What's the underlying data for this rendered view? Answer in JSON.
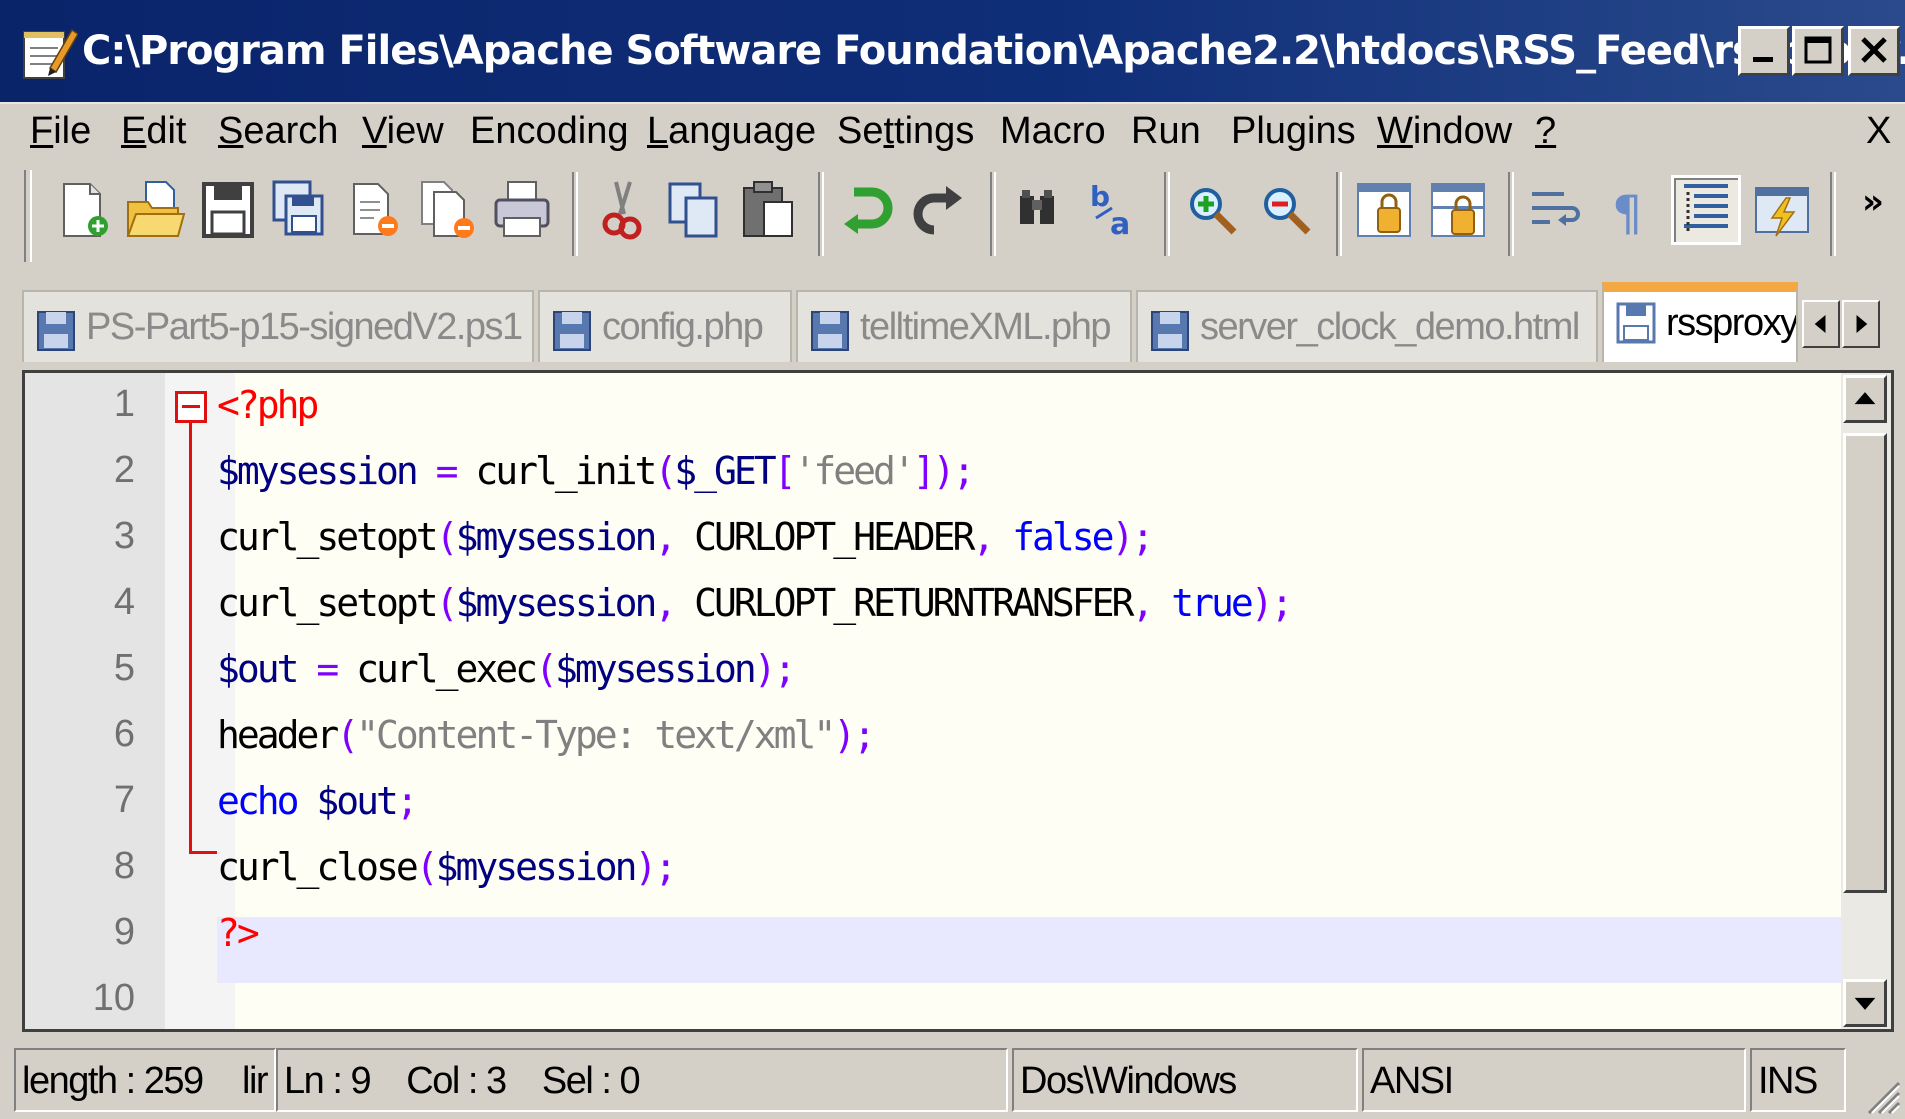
{
  "window": {
    "title": "C:\\Program Files\\Apache Software Foundation\\Apache2.2\\htdocs\\RSS_Feed\\rssproxy.php",
    "app_icon": "notepad-icon",
    "title_color": "#0a246a"
  },
  "menu": {
    "items": [
      {
        "label": "File",
        "accel": "F"
      },
      {
        "label": "Edit",
        "accel": "E"
      },
      {
        "label": "Search",
        "accel": "S"
      },
      {
        "label": "View",
        "accel": "V"
      },
      {
        "label": "Encoding",
        "accel": ""
      },
      {
        "label": "Language",
        "accel": "L"
      },
      {
        "label": "Settings",
        "accel": "t"
      },
      {
        "label": "Macro",
        "accel": ""
      },
      {
        "label": "Run",
        "accel": ""
      },
      {
        "label": "Plugins",
        "accel": ""
      },
      {
        "label": "Window",
        "accel": "W"
      },
      {
        "label": "?",
        "accel": "?"
      }
    ],
    "close_label": "X"
  },
  "toolbar": {
    "buttons": [
      "new-file",
      "open-file",
      "save",
      "save-all",
      "close",
      "close-all",
      "print",
      "cut",
      "copy",
      "paste",
      "undo",
      "redo",
      "find",
      "replace",
      "zoom-in",
      "zoom-out",
      "sync-vertical",
      "sync-horizontal",
      "word-wrap",
      "show-all-characters",
      "indent-guide",
      "user-defined-language"
    ],
    "more_label": "»"
  },
  "tabs": [
    {
      "label": "PS-Part5-p15-signedV2.ps1",
      "active": false
    },
    {
      "label": "config.php",
      "active": false
    },
    {
      "label": "telltimeXML.php",
      "active": false
    },
    {
      "label": "server_clock_demo.html",
      "active": false
    },
    {
      "label": "rssproxy.php",
      "active": true
    }
  ],
  "editor": {
    "lines": [
      {
        "num": "1",
        "tokens": [
          {
            "t": "<?php",
            "c": "k-tag"
          }
        ]
      },
      {
        "num": "2",
        "tokens": [
          {
            "t": "$mysession",
            "c": "k-var"
          },
          {
            "t": " = ",
            "c": "k-op"
          },
          {
            "t": "curl_init",
            "c": "k-fn"
          },
          {
            "t": "(",
            "c": "k-op"
          },
          {
            "t": "$_GET",
            "c": "k-var"
          },
          {
            "t": "[",
            "c": "k-op"
          },
          {
            "t": "'feed'",
            "c": "k-sq"
          },
          {
            "t": "]);",
            "c": "k-op"
          }
        ]
      },
      {
        "num": "3",
        "tokens": [
          {
            "t": "curl_setopt",
            "c": "k-fn"
          },
          {
            "t": "(",
            "c": "k-op"
          },
          {
            "t": "$mysession",
            "c": "k-var"
          },
          {
            "t": ", ",
            "c": "k-op"
          },
          {
            "t": "CURLOPT_HEADER",
            "c": "k-const"
          },
          {
            "t": ", ",
            "c": "k-op"
          },
          {
            "t": "false",
            "c": "k-kw"
          },
          {
            "t": ");",
            "c": "k-op"
          }
        ]
      },
      {
        "num": "4",
        "tokens": [
          {
            "t": "curl_setopt",
            "c": "k-fn"
          },
          {
            "t": "(",
            "c": "k-op"
          },
          {
            "t": "$mysession",
            "c": "k-var"
          },
          {
            "t": ", ",
            "c": "k-op"
          },
          {
            "t": "CURLOPT_RETURNTRANSFER",
            "c": "k-const"
          },
          {
            "t": ", ",
            "c": "k-op"
          },
          {
            "t": "true",
            "c": "k-kw"
          },
          {
            "t": ");",
            "c": "k-op"
          }
        ]
      },
      {
        "num": "5",
        "tokens": [
          {
            "t": "$out",
            "c": "k-var"
          },
          {
            "t": " = ",
            "c": "k-op"
          },
          {
            "t": "curl_exec",
            "c": "k-fn"
          },
          {
            "t": "(",
            "c": "k-op"
          },
          {
            "t": "$mysession",
            "c": "k-var"
          },
          {
            "t": ");",
            "c": "k-op"
          }
        ]
      },
      {
        "num": "6",
        "tokens": [
          {
            "t": "header",
            "c": "k-fn"
          },
          {
            "t": "(",
            "c": "k-op"
          },
          {
            "t": "\"Content-Type: text/xml\"",
            "c": "k-str"
          },
          {
            "t": ");",
            "c": "k-op"
          }
        ]
      },
      {
        "num": "7",
        "tokens": [
          {
            "t": "echo",
            "c": "k-kw"
          },
          {
            "t": " ",
            "c": "k-op"
          },
          {
            "t": "$out",
            "c": "k-var"
          },
          {
            "t": ";",
            "c": "k-op"
          }
        ]
      },
      {
        "num": "8",
        "tokens": [
          {
            "t": "curl_close",
            "c": "k-fn"
          },
          {
            "t": "(",
            "c": "k-op"
          },
          {
            "t": "$mysession",
            "c": "k-var"
          },
          {
            "t": ");",
            "c": "k-op"
          }
        ]
      },
      {
        "num": "9",
        "tokens": [
          {
            "t": "?>",
            "c": "k-tag"
          }
        ]
      },
      {
        "num": "10",
        "tokens": []
      }
    ],
    "current_line": 9
  },
  "status": {
    "length": "length : 259",
    "lines": "lir",
    "position": "Ln : 9    Col : 3    Sel : 0",
    "eol": "Dos\\Windows",
    "encoding": "ANSI",
    "mode": "INS"
  }
}
